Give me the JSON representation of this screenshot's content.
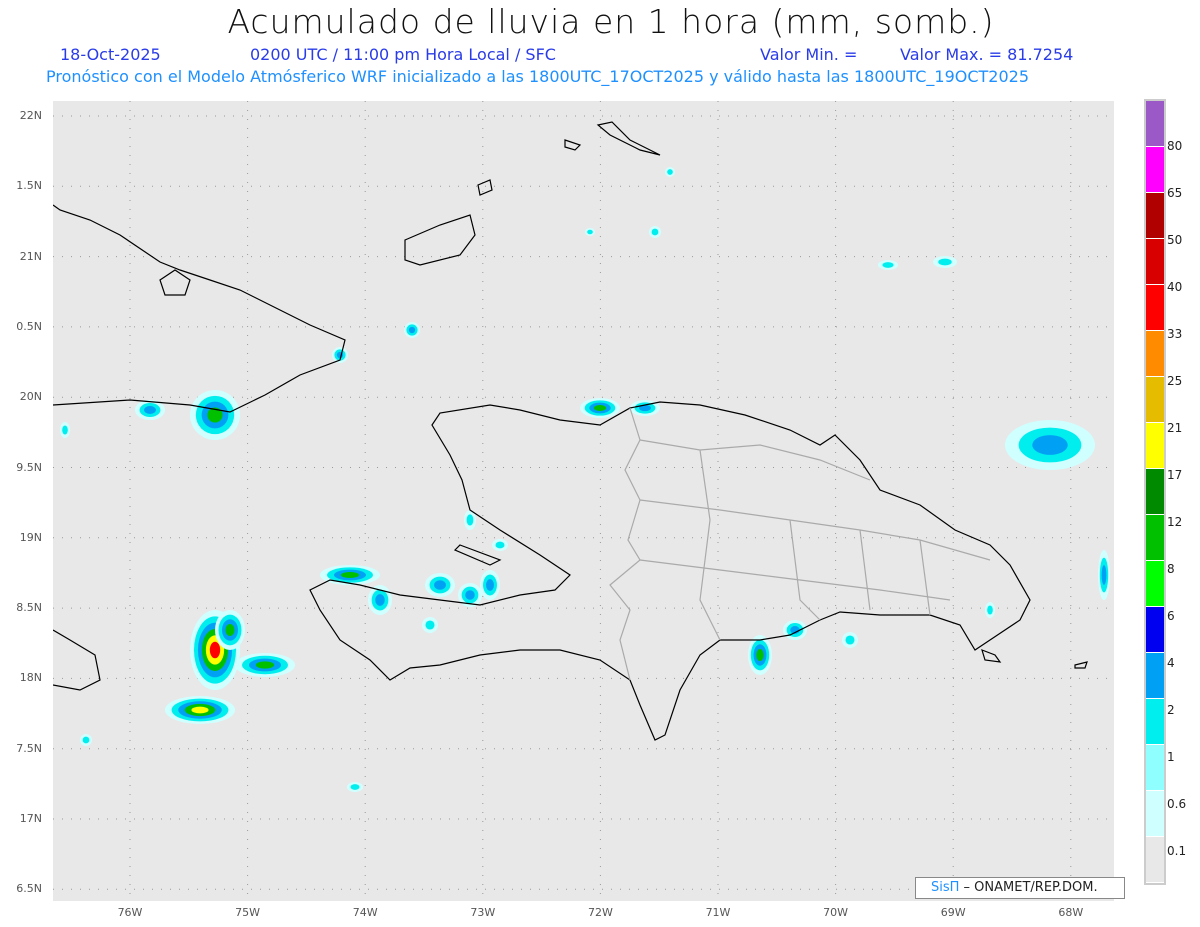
{
  "header": {
    "title": "Acumulado de lluvia en 1 hora (mm, somb.)",
    "date": "18-Oct-2025",
    "time": "0200 UTC / 11:00 pm Hora Local / SFC",
    "min_label": "Valor Min. =",
    "max_label": "Valor Max. = 81.7254",
    "forecast_info": "Pronóstico con el Modelo Atmósferico WRF inicializado a las 1800UTC_17OCT2025 y válido hasta las  1800UTC_19OCT2025"
  },
  "axes": {
    "lat_labels": [
      "22N",
      "1.5N",
      "21N",
      "0.5N",
      "20N",
      "9.5N",
      "19N",
      "8.5N",
      "18N",
      "7.5N",
      "17N",
      "6.5N"
    ],
    "lon_labels": [
      "76W",
      "75W",
      "74W",
      "73W",
      "72W",
      "71W",
      "70W",
      "69W",
      "68W"
    ]
  },
  "colorbar": {
    "labels": [
      "80",
      "65",
      "50",
      "40",
      "33",
      "25",
      "21",
      "17",
      "12",
      "8",
      "6",
      "4",
      "2",
      "1",
      "0.6",
      "0.1"
    ],
    "colors": [
      "#9b59c8",
      "#ff00ff",
      "#b00000",
      "#d80000",
      "#ff0000",
      "#ff8c00",
      "#e6bc00",
      "#ffff00",
      "#008a00",
      "#00c000",
      "#00ff00",
      "#0000f0",
      "#00a0f5",
      "#00eeee",
      "#90ffff",
      "#d0ffff",
      "#e8e8e8"
    ]
  },
  "credit": {
    "brand": "SisΠ",
    "text": " –  ONAMET/REP.DOM."
  }
}
